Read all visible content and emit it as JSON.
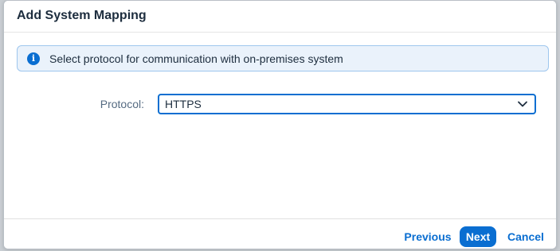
{
  "dialog": {
    "title": "Add System Mapping"
  },
  "info": {
    "icon": "info-icon",
    "glyph": "i",
    "message": "Select protocol for communication with on-premises system"
  },
  "form": {
    "protocol_label": "Protocol:",
    "protocol_value": "HTTPS",
    "dropdown_icon": "chevron-down-icon"
  },
  "footer": {
    "previous_label": "Previous",
    "next_label": "Next",
    "cancel_label": "Cancel"
  },
  "colors": {
    "accent": "#0a6ed1",
    "info_background": "#eaf2fb",
    "info_border": "#9ec6ee",
    "text": "#1d2d3e",
    "label": "#556b82"
  }
}
